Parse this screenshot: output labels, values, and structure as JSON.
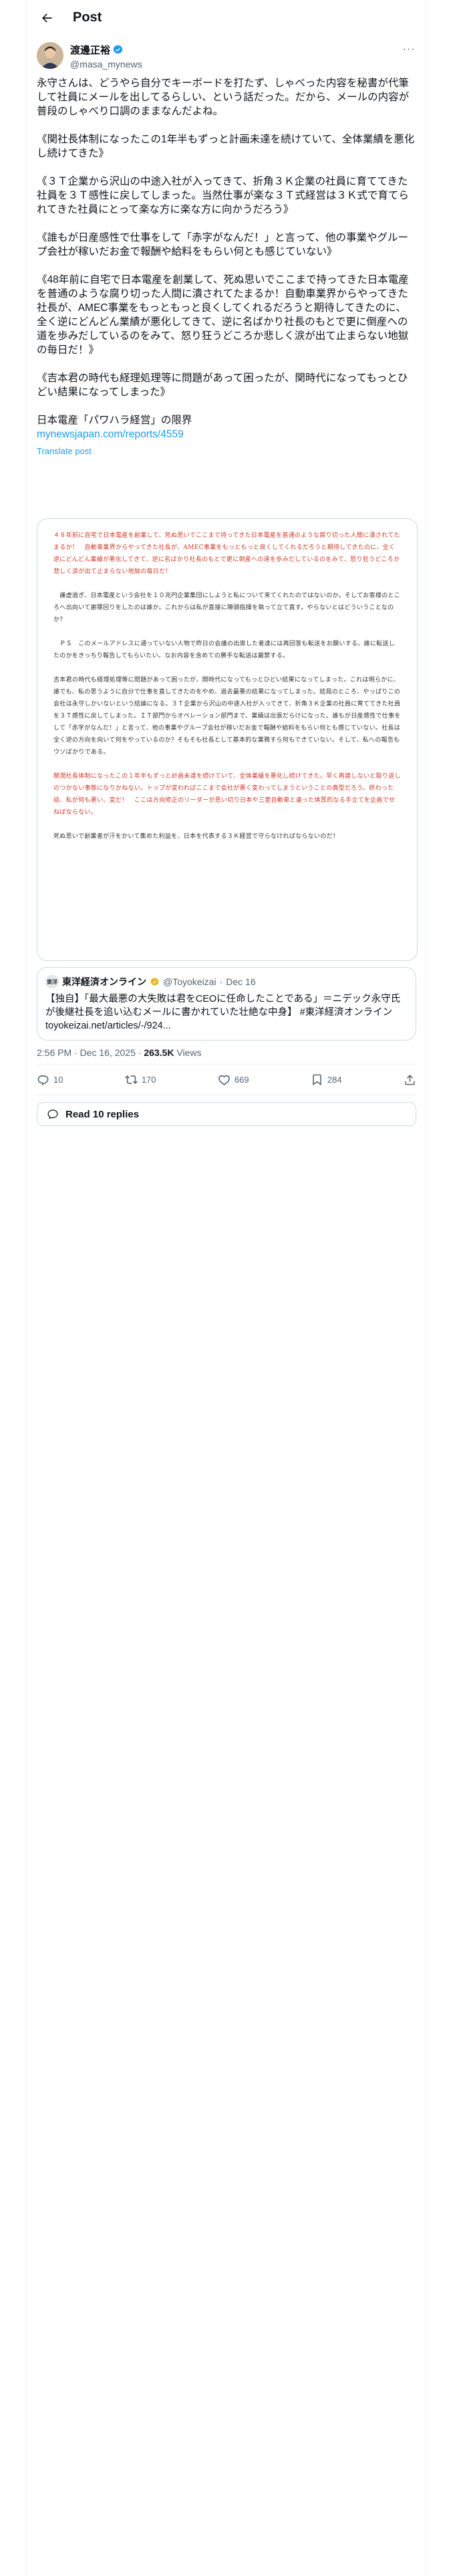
{
  "header": {
    "title": "Post"
  },
  "author": {
    "display_name": "渡邊正裕",
    "handle": "@masa_mynews",
    "more": "···"
  },
  "tweet": {
    "paragraphs": [
      "永守さんは、どうやら自分でキーボードを打たず、しゃべった内容を秘書が代筆して社員にメールを出してるらしい、という話だった。だから、メールの内容が普段のしゃべり口調のままなんだよね。",
      "《関社長体制になったこの1年半もずっと計画未達を続けていて、全体業績を悪化し続けてきた》",
      "《３Ｔ企業から沢山の中途入社が入ってきて、折角３Ｋ企業の社員に育ててきた社員を３Ｔ感性に戻してしまった。当然仕事が楽な３Ｔ式経営は３Ｋ式で育てられてきた社員にとって楽な方に楽な方に向かうだろう》",
      "《誰もが日産感性で仕事をして「赤字がなんだ！」と言って、他の事業やグループ会社が稼いだお金で報酬や給料をもらい何とも感じていない》",
      "《48年前に自宅で日本電産を創業して、死ぬ思いでここまで持ってきた日本電産を普通のような腐り切った人間に潰されてたまるか！自動車業界からやってきた社長が、AMEC事業をもっともっと良くしてくれるだろうと期待してきたのに、全く逆にどんどん業績が悪化してきて、逆に名ばかり社長のもとで更に倒産への道を歩みだしているのをみて、怒り狂うどころか悲しく涙が出て止まらない地獄の毎日だ！》",
      "《吉本君の時代も経理処理等に問題があって困ったが、関時代になってもっとひどい結果になってしまった》"
    ],
    "book_title": "日本電産「パワハラ経営」の限界",
    "link": "mynewsjapan.com/reports/4559",
    "translate": "Translate post"
  },
  "media_image": {
    "lines": [
      {
        "text": "４８年前に自宅で日本電産を創業して、死ぬ思いでここまで持ってきた日本電産を普通のような腐り切った人間に潰されてたまるか！　自動車業界からやってきた社長が、AMEC事業をもっともっと良くしてくれるだろうと期待してきたのに、全く逆にどんどん業績が悪化してきて、逆に名ばかり社長のもとで更に倒産への道を歩みだしているのをみて、怒り狂うどころか悲しく涙が出て止まらない地獄の毎日だ！",
        "red": true
      },
      {
        "text": "　謙虚過ぎ、日本電産という会社を１０兆円企業集団にしようと私について来てくれたのではないのか。そしてお客様のところへ出向いて謝罪回りをしたのは誰か。これからは私が直接に陣頭指揮を執って立て直す。やらないとはどういうことなのか？",
        "red": false
      },
      {
        "text": "　ＰＳ　このメールアドレスに通っていない人物で昨日の会議の出席した者達には再回答も転送をお願いする。誰に転送したのかをきっちり報告してもらいたい。なお内容を含めての勝手な転送は厳禁する。",
        "red": false
      },
      {
        "text": "吉本君の時代も経理処理等に問題があって困ったが、関時代になってもっとひどい結果になってしまった。これは明らかに、誰でも、私の思うように自分で仕事を直してきたのをやめ、過去最悪の結果になってしまった。結局のところ、やっぱりこの会社は永守しかいないという結論になる。３Ｔ企業から沢山の中途入社が入ってきて、折角３Ｋ企業の社員に育ててきた社員を３Ｔ感性に戻してしまった。ＩＴ部門からオペレーション部門まで、業績は出張だらけになった。誰もが日産感性で仕事をして「赤字がなんだ！」と言って、他の事業やグループ会社が稼いだお金で報酬や給料をもらい何とも感じていない。社長は全く逆の方向を向いて何をやっているのか？そもそも社長として基本的な業務すら何もできていない。そして、私への報告もウソばかりである。",
        "red": false
      },
      {
        "text": "関潤社長体制になったこの１年半もずっと計画未達を続けていて、全体業績を悪化し続けてきた。早く再建しないと取り返しのつかない事態になりかねない。トップが変わればここまで会社が悪く変わってしまうということの典型だろう。終わった話、私が何も悪い、変だ！　ここは方向修正のリーダーが思い切り日本や三菱自動車と違った体質的なる手立てを企画でせねばならない。",
        "red": true
      },
      {
        "text": "死ぬ思いで創業者が汗をかいて集めた利益を、日本を代表する３Ｋ経営で守らなければならないのだ！",
        "red": false
      }
    ]
  },
  "quote": {
    "source_name": "東洋経済オンライン",
    "handle": "@Toyokeizai",
    "date": "Dec 16",
    "logo_text": "東洋",
    "text": "【独自】「最大最悪の大失敗は君をCEOに任命したことである」＝ニデック永守氏が後継社長を追い込むメールに書かれていた壮絶な中身】 #東洋経済オンライン",
    "link": "toyokeizai.net/articles/-/924..."
  },
  "meta": {
    "time": "2:56 PM · Dec 16, 2025 · ",
    "views_count": "263.5K",
    "views_label": " Views"
  },
  "actions": {
    "replies": "10",
    "reposts": "170",
    "likes": "669",
    "bookmarks": "284"
  },
  "read_replies": "Read 10 replies",
  "colors": {
    "accent": "#1d9bf0",
    "text": "#0f1419",
    "muted": "#536471",
    "border": "#cfd9de",
    "red_text": "#d03a2a"
  }
}
